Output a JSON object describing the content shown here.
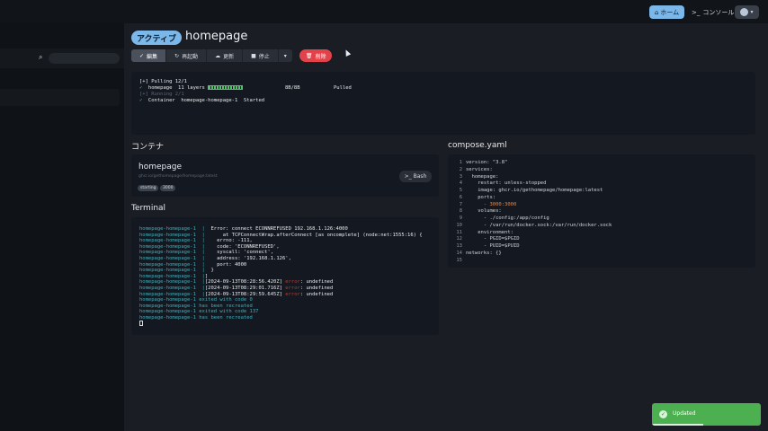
{
  "topbar": {
    "home_label": "ホーム",
    "console_label": "コンソール"
  },
  "header": {
    "status": "アクティブ",
    "title": "homepage"
  },
  "toolbar": {
    "edit": "編集",
    "restart": "再起動",
    "update": "更新",
    "stop": "停止",
    "delete": "削除"
  },
  "output": {
    "lines": [
      "[+] Pulling 12/1",
      "  homepage  11 layers",
      "8B/8B",
      "Pulled",
      "[+] Running 2/1",
      "  Container  homepage-homepage-1  Started"
    ]
  },
  "sections": {
    "containers": "コンテナ",
    "terminal": "Terminal",
    "compose": "compose.yaml"
  },
  "container": {
    "name": "homepage",
    "image": "ghcr.io/gethomepage/homepage:latest",
    "state": "starting",
    "port": "3000",
    "bash_label": "Bash"
  },
  "terminal": {
    "lines": [
      {
        "prefix": "homepage-homepage-1  |",
        "text": "  Error: connect ECONNREFUSED 192.168.1.126:4000"
      },
      {
        "prefix": "homepage-homepage-1  |",
        "text": "      at TCPConnectWrap.afterConnect [as oncomplete] (node:net:1555:16) {"
      },
      {
        "prefix": "homepage-homepage-1  |",
        "text": "    errno: -111,"
      },
      {
        "prefix": "homepage-homepage-1  |",
        "text": "    code: 'ECONNREFUSED',"
      },
      {
        "prefix": "homepage-homepage-1  |",
        "text": "    syscall: 'connect',"
      },
      {
        "prefix": "homepage-homepage-1  |",
        "text": "    address: '192.168.1.126',"
      },
      {
        "prefix": "homepage-homepage-1  |",
        "text": "    port: 4000"
      },
      {
        "prefix": "homepage-homepage-1  |",
        "text": "  }"
      },
      {
        "prefix": "homepage-homepage-1  |",
        "text": "]"
      },
      {
        "prefix": "homepage-homepage-1  |",
        "text": "[2024-09-13T08:28:56.420Z]",
        "level": "error",
        "tail": ": undefined"
      },
      {
        "prefix": "homepage-homepage-1  |",
        "text": "[2024-09-13T08:29:01.716Z]",
        "level": "error",
        "tail": ": undefined"
      },
      {
        "prefix": "homepage-homepage-1  |",
        "text": "[2024-09-13T08:29:59.645Z]",
        "level": "error",
        "tail": ": undefined"
      },
      {
        "prefix": "homepage-homepage-1 exited with code 0",
        "text": ""
      },
      {
        "prefix": "homepage-homepage-1 has been recreated",
        "text": ""
      },
      {
        "prefix": "homepage-homepage-1 exited with code 137",
        "text": ""
      },
      {
        "prefix": "homepage-homepage-1 has been recreated",
        "text": ""
      }
    ]
  },
  "compose": {
    "lines": [
      "version: \"3.8\"",
      "services:",
      "  homepage:",
      "    restart: unless-stopped",
      "    image: ghcr.io/gethomepage/homepage:latest",
      "    ports:",
      "      - 3000:3000",
      "    volumes:",
      "      - ./config:/app/config",
      "      - /var/run/docker.sock:/var/run/docker.sock",
      "    environment:",
      "      - PGID=$PGID",
      "      - PUID=$PUID",
      "networks: {}",
      ""
    ]
  },
  "toast": {
    "message": "Updated",
    "progress": 0.47
  },
  "colors": {
    "accent": "#7cb7ea",
    "danger": "#e2434b",
    "success": "#4caf50"
  }
}
